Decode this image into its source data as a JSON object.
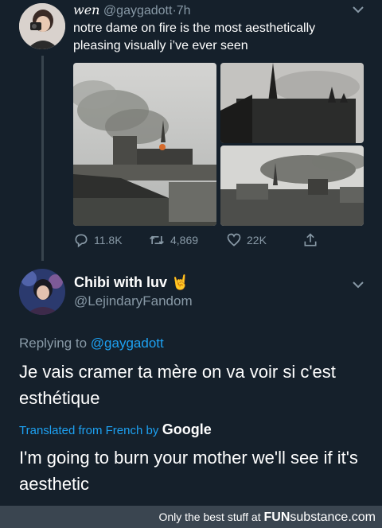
{
  "tweet": {
    "author_name": "wen",
    "handle": "@gaygadott",
    "separator": "·",
    "time": "7h",
    "text": "notre dame on fire is the most aesthetically pleasing visually i’ve ever seen",
    "actions": {
      "replies": "11.8K",
      "retweets": "4,869",
      "likes": "22K"
    }
  },
  "reply": {
    "author_name": "Chibi with luv",
    "author_emoji": "🤘",
    "handle": "@LejindaryFandom",
    "replying_prefix": "Replying to",
    "replying_to": "@gaygadott",
    "text": "Je vais cramer ta mère on va voir si c'est esthétique",
    "translated_by": "Translated from French by",
    "translator": "Google",
    "translation": "I'm going to burn your mother we'll see if it's aesthetic"
  },
  "watermark": {
    "prefix": "Only the best stuff at",
    "brand_bold": "FUN",
    "brand_rest": "substance.com"
  }
}
